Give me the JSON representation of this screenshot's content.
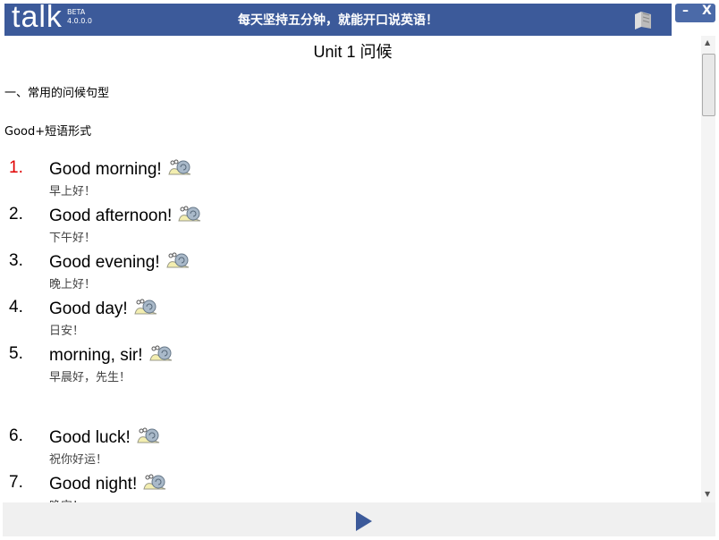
{
  "app": {
    "logo": "talk",
    "beta": "BETA",
    "version": "4.0.0.0",
    "slogan": "每天坚持五分钟，就能开口说英语！",
    "minimize": "–",
    "close": "X"
  },
  "colors": {
    "titlebar": "#3c5a9a",
    "number_highlight": "#e00000"
  },
  "lesson": {
    "title": "Unit 1  问候",
    "section": "一、常用的问候句型",
    "subsection": "Good+短语形式",
    "items": [
      {
        "num": "1.",
        "en": "Good morning!",
        "zh": "早上好！"
      },
      {
        "num": "2.",
        "en": "Good afternoon!",
        "zh": "下午好！"
      },
      {
        "num": "3.",
        "en": "Good evening!",
        "zh": "晚上好！"
      },
      {
        "num": "4.",
        "en": "Good day!",
        "zh": "日安！"
      },
      {
        "num": "5.",
        "en": "morning, sir!",
        "zh": "早晨好，先生！"
      },
      {
        "num": "6.",
        "en": "Good luck!",
        "zh": "祝你好运！"
      },
      {
        "num": "7.",
        "en": "Good night!",
        "zh": "晚安！"
      }
    ]
  },
  "icons": {
    "audio": "snail-icon",
    "play": "play-icon",
    "book": "book-icon"
  }
}
